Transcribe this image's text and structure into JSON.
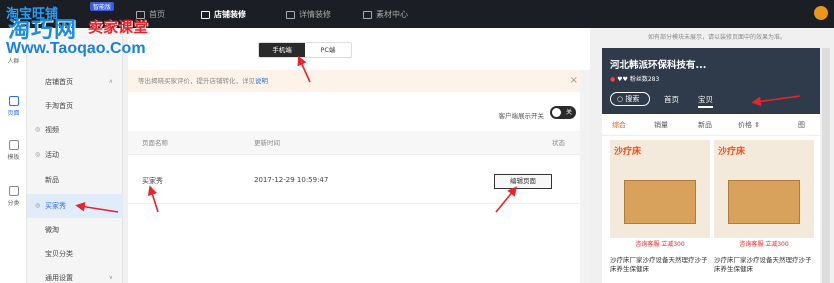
{
  "topbar": {
    "brand": "淘宝旺铺",
    "brand_badge": "智能版",
    "items": [
      {
        "label": "首页"
      },
      {
        "label": "店铺装修"
      },
      {
        "label": "详情装修"
      },
      {
        "label": "素材中心"
      }
    ]
  },
  "watermark": {
    "line1": "淘巧网",
    "line2": "卖家课堂",
    "line3": "Www.Taoqao.Com"
  },
  "rail": [
    {
      "label": "人群"
    },
    {
      "label": "页面"
    },
    {
      "label": "模板"
    },
    {
      "label": "分类"
    }
  ],
  "nav2": {
    "items": [
      {
        "label": "店铺首页",
        "caret": "∧"
      },
      {
        "label": "手淘首页"
      },
      {
        "label": "视频",
        "icon": "◎"
      },
      {
        "label": "活动",
        "icon": "◎"
      },
      {
        "label": "新品"
      },
      {
        "label": "买家秀",
        "icon": "◎"
      },
      {
        "label": "微淘"
      },
      {
        "label": "宝贝分类"
      },
      {
        "label": "通用设置",
        "caret": "∨"
      }
    ]
  },
  "main": {
    "toggle": {
      "mobile": "手机端",
      "pc": "PC端"
    },
    "notice": {
      "text": "等出揭晓买家评价，提升店铺转化，详见",
      "link": "说明",
      "close": "×"
    },
    "switch": {
      "label": "客户端展示开关",
      "state": "关"
    },
    "table": {
      "headers": [
        "页面名称",
        "更新时间",
        "状态"
      ],
      "rows": [
        {
          "name": "买家秀",
          "time": "2017-12-29 10:59:47",
          "action": "编辑页面"
        }
      ]
    }
  },
  "preview": {
    "tip": "如有部分模块未展示，请以装修页面中的效果为准。",
    "shop_title": "河北韩派环保科技有...",
    "shop_rating": "♥♥ 粉丝数283",
    "search": "搜索",
    "tabs": [
      "首页",
      "宝贝"
    ],
    "sort": [
      "综合",
      "销量",
      "新品",
      "价格",
      "图"
    ],
    "products": [
      {
        "banner": "沙疗床",
        "strip": "咨询客服 立减300",
        "desc": "沙疗床厂家沙疗设备天然理疗沙子床养生保健床"
      },
      {
        "banner": "沙疗床",
        "strip": "咨询客服 立减300",
        "desc": "沙疗床厂家沙疗设备天然理疗沙子床养生保健床"
      }
    ]
  }
}
